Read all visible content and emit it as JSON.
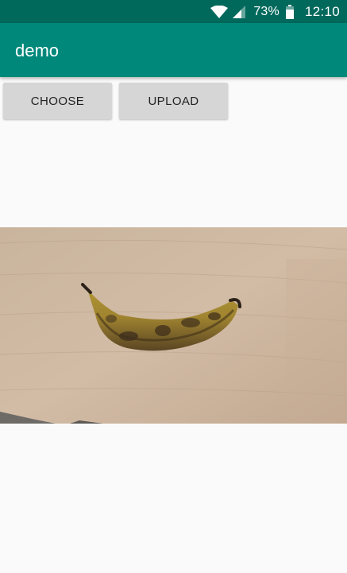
{
  "status_bar": {
    "battery_percent": "73%",
    "time": "12:10",
    "icons": [
      "wifi-icon",
      "signal-icon",
      "battery-icon"
    ]
  },
  "app_bar": {
    "title": "demo"
  },
  "buttons": {
    "choose_label": "CHOOSE",
    "upload_label": "UPLOAD"
  },
  "image": {
    "subject": "banana-photo"
  },
  "colors": {
    "status_bar": "#00695c",
    "app_bar": "#00897b",
    "button": "#d6d6d6",
    "background": "#fafafa"
  }
}
